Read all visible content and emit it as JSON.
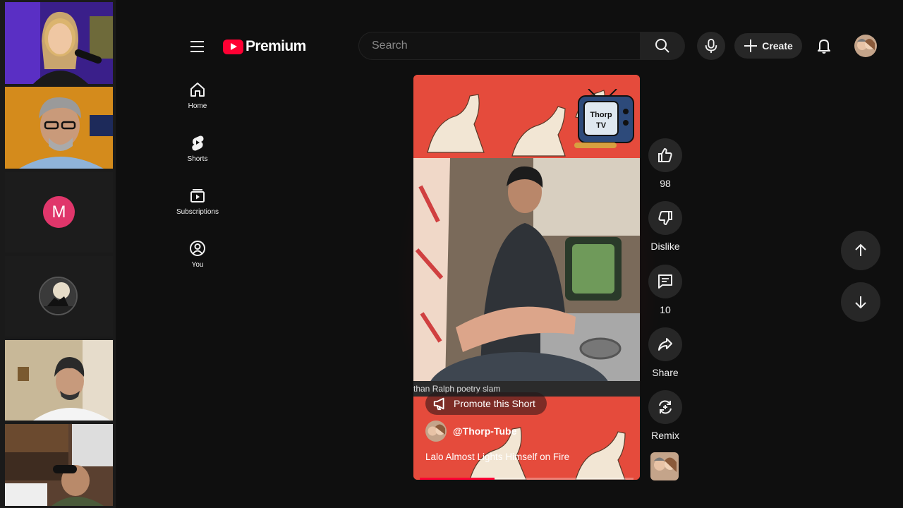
{
  "call": {
    "participant_initial": "M"
  },
  "topbar": {
    "logo_text": "Premium",
    "search_placeholder": "Search",
    "create_label": "Create"
  },
  "guide": {
    "items": [
      {
        "label": "Home",
        "icon": "home-icon"
      },
      {
        "label": "Shorts",
        "icon": "shorts-icon"
      },
      {
        "label": "Subscriptions",
        "icon": "subscriptions-icon"
      },
      {
        "label": "You",
        "icon": "you-icon"
      }
    ]
  },
  "short": {
    "caption_text": "than Ralph poetry slam",
    "promote_label": "Promote this Short",
    "channel_handle": "@Thorp-Tube",
    "title": "Lalo Almost Lights Himself on Fire",
    "badge_text": "Thorp TV",
    "progress": 0.35
  },
  "actions": {
    "like_count": "98",
    "dislike_label": "Dislike",
    "comment_count": "10",
    "share_label": "Share",
    "remix_label": "Remix"
  },
  "colors": {
    "accent": "#ff0033",
    "background": "#0f0f0f",
    "button": "#272727",
    "participant_m": "#e0366b"
  }
}
